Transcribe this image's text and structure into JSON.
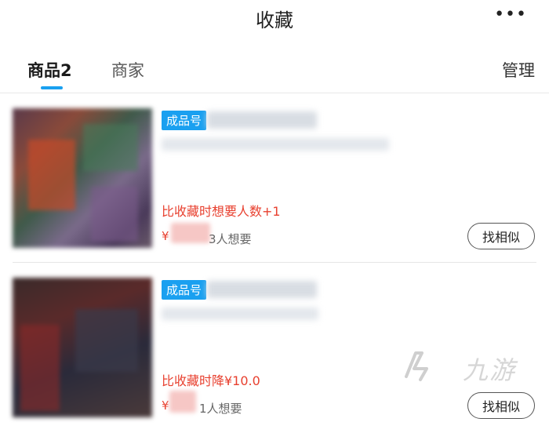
{
  "header": {
    "title": "收藏",
    "more_label": "•••"
  },
  "tabs": {
    "active_label": "商品2",
    "inactive_label": "商家",
    "manage_label": "管理"
  },
  "items": [
    {
      "badge": "成品号",
      "promo": "比收藏时想要人数+1",
      "currency": "¥",
      "want": "3人想要",
      "action_label": "找相似"
    },
    {
      "badge": "成品号",
      "promo": "比收藏时降¥10.0",
      "currency": "¥",
      "want": "1人想要",
      "action_label": "找相似"
    }
  ],
  "watermark": {
    "text": "九游"
  },
  "colors": {
    "accent": "#1aa0f0",
    "promo": "#e8402f"
  }
}
